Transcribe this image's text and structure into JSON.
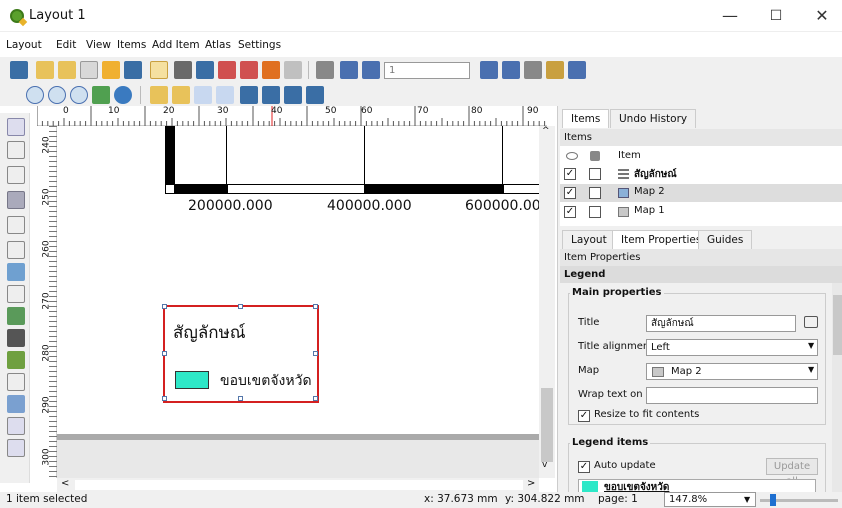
{
  "window": {
    "title": "Layout 1",
    "minimize": "—",
    "maximize": "☐",
    "close": "✕"
  },
  "menu": [
    "Layout",
    "Edit",
    "View",
    "Items",
    "Add Item",
    "Atlas",
    "Settings"
  ],
  "toolbar": {
    "page_field": "1"
  },
  "ruler": {
    "h_ticks": [
      "0",
      "10",
      "20",
      "30",
      "40",
      "50",
      "60",
      "70",
      "80",
      "90"
    ],
    "v_ticks": [
      "240",
      "250",
      "260",
      "270",
      "280",
      "290",
      "300"
    ]
  },
  "canvas": {
    "scalebar_labels": [
      "200000.000",
      "400000.000",
      "600000.00"
    ],
    "legend_title": "สัญลักษณ์",
    "legend_item": "ขอบเขตจังหวัด",
    "legend_color": "#2ee8c8",
    "frame_color": "#d42020"
  },
  "panel": {
    "tabs_top": [
      "Items",
      "Undo History"
    ],
    "items_header": "Items",
    "items_col": "Item",
    "items": [
      {
        "label": "สัญลักษณ์",
        "checked": "✓"
      },
      {
        "label": "Map 2",
        "checked": "✓"
      },
      {
        "label": "Map 1",
        "checked": "✓"
      }
    ],
    "tabs_mid": [
      "Layout",
      "Item Properties",
      "Guides"
    ],
    "props_header": "Item Properties",
    "props_sub": "Legend",
    "main_props": "Main properties",
    "title_label": "Title",
    "title_value": "สัญลักษณ์",
    "align_label": "Title alignment",
    "align_value": "Left",
    "map_label": "Map",
    "map_value": "Map 2",
    "wrap_label": "Wrap text on",
    "resize_label": "Resize to fit contents",
    "legend_items": "Legend items",
    "auto_update": "Auto update",
    "update_all": "Update all",
    "legend_entry": "ขอบเขตจังหวัด"
  },
  "status": {
    "selection": "1 item selected",
    "x": "x: 37.673 mm",
    "y": "y: 304.822 mm",
    "page": "page: 1",
    "zoom": "147.8%"
  }
}
